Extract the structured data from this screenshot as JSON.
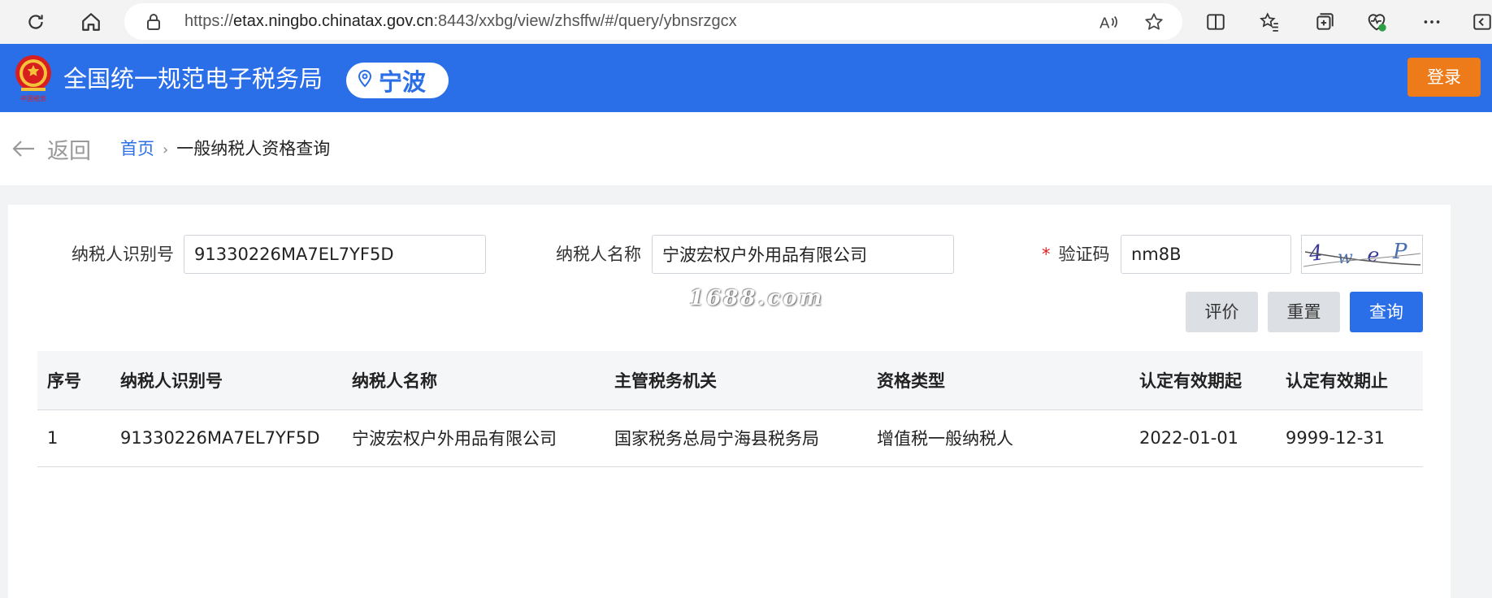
{
  "browser": {
    "url_prefix": "https://",
    "url_host": "etax.ningbo.chinatax.gov.cn",
    "url_rest": ":8443/xxbg/view/zhsffw/#/query/ybnsrzgcx"
  },
  "header": {
    "site_title": "全国统一规范电子税务局",
    "city": "宁波",
    "login_label": "登录",
    "accent_color": "#2b6fe8",
    "login_color": "#ee7b19"
  },
  "breadcrumb": {
    "back_label": "返回",
    "home": "首页",
    "current": "一般纳税人资格查询"
  },
  "form": {
    "taxpayer_id_label": "纳税人识别号",
    "taxpayer_id_value": "91330226MA7EL7YF5D",
    "taxpayer_name_label": "纳税人名称",
    "taxpayer_name_value": "宁波宏权户外用品有限公司",
    "captcha_required_mark": "*",
    "captcha_label": "验证码",
    "captcha_value": "nm8B",
    "captcha_image_text": "4weP",
    "watermark": "1688.com"
  },
  "actions": {
    "evaluate_label": "评价",
    "reset_label": "重置",
    "query_label": "查询"
  },
  "table": {
    "headers": [
      "序号",
      "纳税人识别号",
      "纳税人名称",
      "主管税务机关",
      "资格类型",
      "认定有效期起",
      "认定有效期止"
    ],
    "rows": [
      [
        "1",
        "91330226MA7EL7YF5D",
        "宁波宏权户外用品有限公司",
        "国家税务总局宁海县税务局",
        "增值税一般纳税人",
        "2022-01-01",
        "9999-12-31"
      ]
    ]
  }
}
